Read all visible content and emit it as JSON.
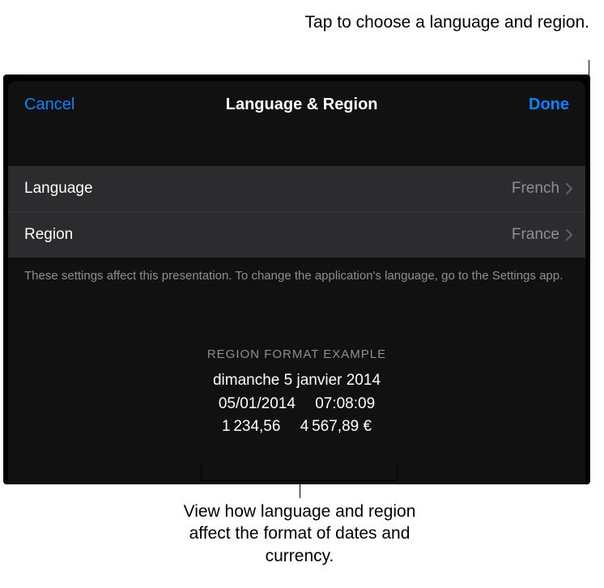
{
  "annotations": {
    "top": "Tap to choose a language and region.",
    "bottom": "View how language and region affect the format of dates and currency."
  },
  "nav": {
    "cancel": "Cancel",
    "title": "Language & Region",
    "done": "Done"
  },
  "rows": {
    "language": {
      "label": "Language",
      "value": "French"
    },
    "region": {
      "label": "Region",
      "value": "France"
    }
  },
  "footer": "These settings affect this presentation. To change the application's language, go to the Settings app.",
  "example": {
    "header": "REGION FORMAT EXAMPLE",
    "line1": "dimanche 5 janvier 2014",
    "line2": "05/01/2014  07:08:09",
    "line3": "1 234,56  4 567,89 €"
  }
}
